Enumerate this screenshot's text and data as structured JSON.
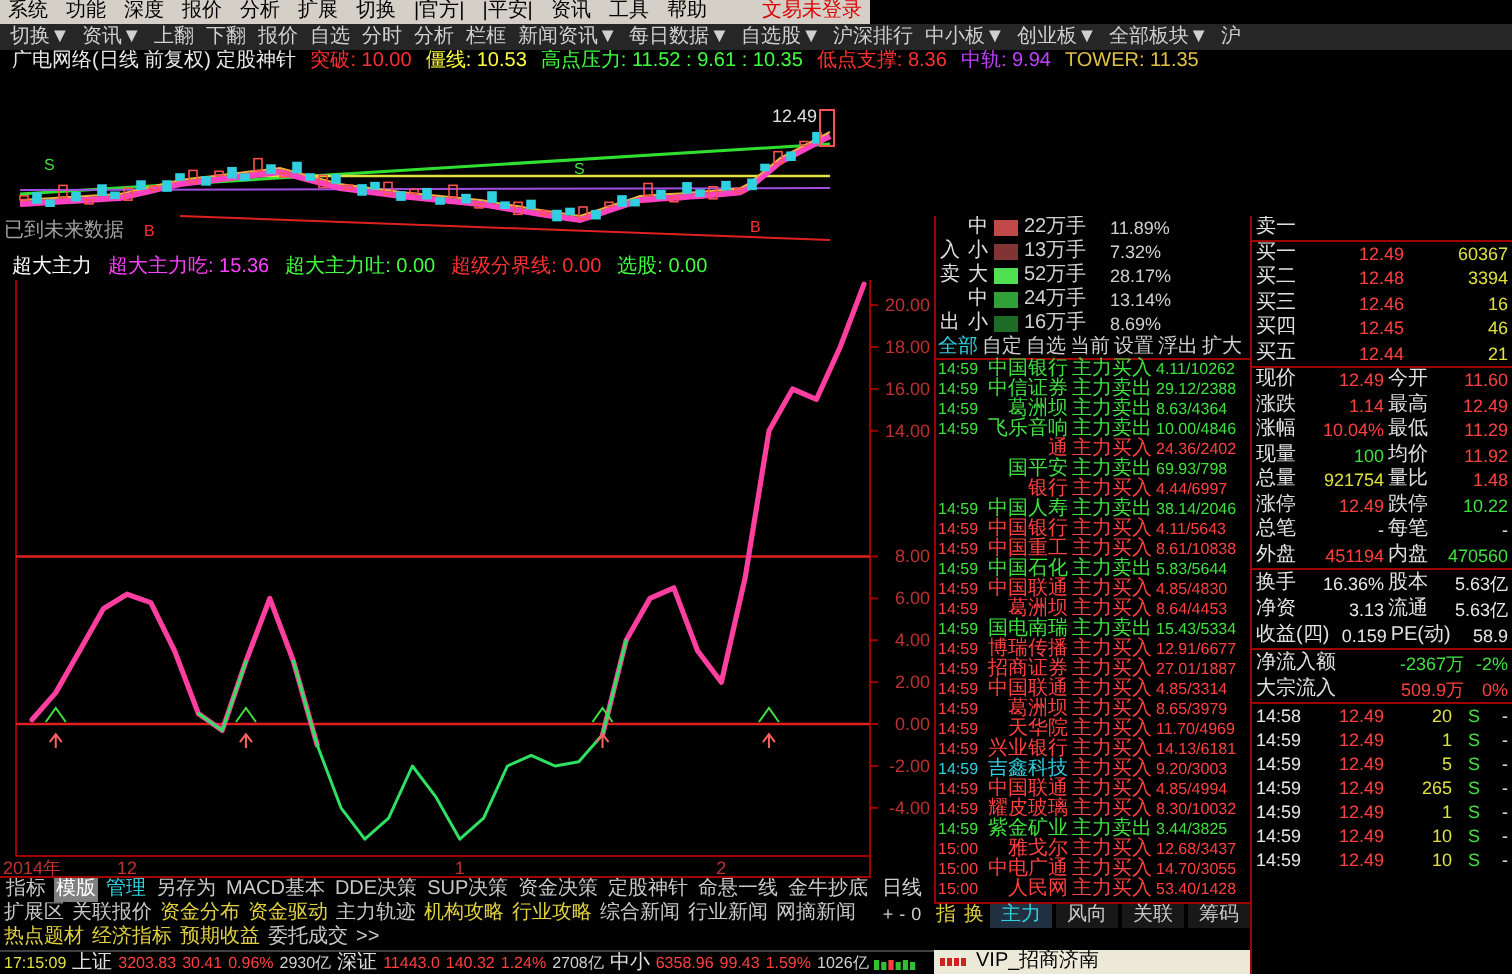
{
  "menu": {
    "items": [
      "系统",
      "功能",
      "深度",
      "报价",
      "分析",
      "扩展",
      "切换",
      "|官方|",
      "|平安|",
      "资讯",
      "工具",
      "帮助"
    ],
    "login_status": "文易未登录"
  },
  "toolbar": [
    "切换▼",
    "资讯▼",
    "上翻",
    "下翻",
    "报价",
    "自选",
    "分时",
    "分析",
    "栏框",
    "新闻资讯▼",
    "每日数据▼",
    "自选股▼",
    "沪深排行",
    "中小板▼",
    "创业板▼",
    "全部板块▼",
    "沪"
  ],
  "chart_info": {
    "title": "广电网络(日线 前复权) 定股神针",
    "items": [
      {
        "text": "突破: 10.00",
        "color": "#ff3030"
      },
      {
        "text": "僵线: 10.53",
        "color": "#ffff40"
      },
      {
        "text": "高点压力: 11.52 : 9.61 : 10.35",
        "color": "#40ff40"
      },
      {
        "text": "低点支撑: 8.36",
        "color": "#ff3030"
      },
      {
        "text": "中轨: 9.94",
        "color": "#c040ff"
      },
      {
        "text": "TOWER: 11.35",
        "color": "#e0c040"
      }
    ]
  },
  "price_chart": {
    "last_price": "12.49",
    "notice": "已到未来数据",
    "signals": [
      {
        "kind": "sell",
        "label": "S"
      },
      {
        "kind": "buy",
        "label": "B"
      },
      {
        "kind": "sell",
        "label": "S"
      },
      {
        "kind": "buy",
        "label": "B"
      }
    ]
  },
  "indicator": {
    "title": "超大主力",
    "values": [
      {
        "text": "超大主力吃: 15.36",
        "color": "#ff40ff"
      },
      {
        "text": "超大主力吐: 0.00",
        "color": "#40ff40"
      },
      {
        "text": "超级分界线: 0.00",
        "color": "#ff3030"
      },
      {
        "text": "选股: 0.00",
        "color": "#40ff40"
      }
    ],
    "chart_data": {
      "type": "line",
      "categories": [
        "2014年",
        null,
        null,
        null,
        "12",
        null,
        null,
        null,
        null,
        null,
        null,
        null,
        null,
        null,
        null,
        null,
        null,
        null,
        "1",
        null,
        null,
        null,
        null,
        null,
        null,
        null,
        null,
        null,
        null,
        "2",
        null,
        null,
        null,
        null,
        null,
        null
      ],
      "series": [
        {
          "color": "#ff3fa0",
          "values": [
            0.2,
            1.5,
            3.5,
            5.5,
            6.2,
            5.8,
            3.5,
            0.5,
            -0.3,
            3,
            6,
            3,
            -1,
            null,
            null,
            null,
            null,
            null,
            null,
            null,
            null,
            null,
            null,
            null,
            -0.5,
            4,
            6,
            6.5,
            3.5,
            2,
            7,
            14,
            16,
            15.5,
            18,
            21
          ]
        },
        {
          "color": "#30e060",
          "values": [
            null,
            null,
            null,
            null,
            null,
            null,
            null,
            0.5,
            -0.3,
            3,
            null,
            3,
            -1,
            -4,
            -5.5,
            -4.5,
            -2,
            -3.5,
            -5.5,
            -4.5,
            -2,
            -1.5,
            -2,
            -1.8,
            -0.5,
            4,
            null,
            null,
            null,
            null,
            null,
            null,
            null,
            null,
            null,
            null
          ]
        }
      ],
      "ylim": [
        -6.3,
        21.2
      ],
      "yticks": [
        {
          "value": 20,
          "label": "20.00"
        },
        {
          "value": 18,
          "label": "18.00"
        },
        {
          "value": 16,
          "label": "16.00"
        },
        {
          "value": 14,
          "label": "14.00"
        },
        {
          "value": 8,
          "label": "8.00"
        },
        {
          "value": 6,
          "label": "6.00"
        },
        {
          "value": 4,
          "label": "4.00"
        },
        {
          "value": 2,
          "label": "2.00"
        },
        {
          "value": 0,
          "label": "0.00"
        },
        {
          "value": -2,
          "label": "-2.00"
        },
        {
          "value": -4,
          "label": "-4.00"
        }
      ]
    }
  },
  "indicator_tabs": [
    {
      "label": "指标",
      "selected": false,
      "highlighted": false
    },
    {
      "label": "模版",
      "selected": true,
      "highlighted": false
    },
    {
      "label": "管理",
      "selected": false,
      "highlighted": true
    },
    {
      "label": "另存为",
      "selected": false,
      "highlighted": false
    },
    {
      "label": "MACD基本",
      "selected": false,
      "highlighted": false
    },
    {
      "label": "DDE决策",
      "selected": false,
      "highlighted": false
    },
    {
      "label": "SUP决策",
      "selected": false,
      "highlighted": false
    },
    {
      "label": "资金决策",
      "selected": false,
      "highlighted": false
    },
    {
      "label": "定股神针",
      "selected": false,
      "highlighted": false
    },
    {
      "label": "命悬一线",
      "selected": false,
      "highlighted": false
    },
    {
      "label": "金牛抄底",
      "selected": false,
      "highlighted": false
    }
  ],
  "period": "日线",
  "zoom_controls": [
    "+",
    "-",
    "0"
  ],
  "extension_tabs": [
    {
      "label": "扩展区",
      "highlighted": false
    },
    {
      "label": "关联报价",
      "highlighted": false
    },
    {
      "label": "资金分布",
      "highlighted": true
    },
    {
      "label": "资金驱动",
      "highlighted": true
    },
    {
      "label": "主力轨迹",
      "highlighted": false
    },
    {
      "label": "机构攻略",
      "highlighted": true
    },
    {
      "label": "行业攻略",
      "highlighted": true
    },
    {
      "label": "综合新闻",
      "highlighted": false
    },
    {
      "label": "行业新闻",
      "highlighted": false
    },
    {
      "label": "网摘新闻",
      "highlighted": false
    },
    {
      "label": "热点题材",
      "highlighted": true
    },
    {
      "label": "经济指标",
      "highlighted": true
    },
    {
      "label": "预期收益",
      "highlighted": true
    },
    {
      "label": "委托成交",
      "highlighted": false
    },
    {
      "label": ">>",
      "highlighted": false
    }
  ],
  "status_bar": {
    "time": "17:15:09",
    "indices": [
      {
        "name": "上证",
        "value": "3203.83",
        "change": "30.41",
        "percent": "0.96%",
        "amount": "2930亿"
      },
      {
        "name": "深证",
        "value": "11443.0",
        "change": "140.32",
        "percent": "1.24%",
        "amount": "2708亿"
      },
      {
        "name": "中小",
        "value": "6358.96",
        "change": "99.43",
        "percent": "1.59%",
        "amount": "1026亿"
      }
    ]
  },
  "vip_label": "VIP_招商济南",
  "money_flow": {
    "rows": [
      {
        "size": "中",
        "amount": "22万手",
        "percent": "11.89%",
        "color": "#c04848"
      },
      {
        "side": "入",
        "size": "小",
        "amount": "13万手",
        "percent": "7.32%",
        "color": "#803434"
      },
      {
        "side": "卖",
        "size": "大",
        "amount": "52万手",
        "percent": "28.17%",
        "color": "#50e050"
      },
      {
        "size": "中",
        "amount": "24万手",
        "percent": "13.14%",
        "color": "#30a038"
      },
      {
        "side": "出",
        "size": "小",
        "amount": "16万手",
        "percent": "8.69%",
        "color": "#206a28"
      }
    ],
    "actions": [
      {
        "label": "全部",
        "selected": true
      },
      {
        "label": "自定",
        "selected": false
      },
      {
        "label": "自选",
        "selected": false
      },
      {
        "label": "当前",
        "selected": false
      },
      {
        "label": "设置",
        "selected": false
      },
      {
        "label": "浮出",
        "selected": false
      },
      {
        "label": "扩大",
        "selected": false
      }
    ]
  },
  "trades": [
    {
      "time": "14:59",
      "name": "中国银行",
      "type": "主力买入",
      "detail": "4.11/10262",
      "color": "#40e040",
      "selected": false
    },
    {
      "time": "14:59",
      "name": "中信证券",
      "type": "主力卖出",
      "detail": "29.12/2388",
      "color": "#40e040",
      "selected": false
    },
    {
      "time": "14:59",
      "name": "葛洲坝",
      "type": "主力卖出",
      "detail": "8.63/4364",
      "color": "#40e040",
      "selected": false
    },
    {
      "time": "14:59",
      "name": "飞乐音响",
      "type": "主力卖出",
      "detail": "10.00/4846",
      "color": "#40e040",
      "selected": false
    },
    {
      "name": "通",
      "type": "主力买入",
      "detail": "24.36/2402",
      "color": "#ff4040",
      "selected": false
    },
    {
      "name": "国平安",
      "type": "主力卖出",
      "detail": "69.93/798",
      "color": "#40e040",
      "selected": false
    },
    {
      "name": "银行",
      "type": "主力买入",
      "detail": "4.44/6997",
      "color": "#ff4040",
      "selected": false
    },
    {
      "time": "14:59",
      "name": "中国人寿",
      "type": "主力卖出",
      "detail": "38.14/2046",
      "color": "#40e040",
      "selected": false
    },
    {
      "time": "14:59",
      "name": "中国银行",
      "type": "主力买入",
      "detail": "4.11/5643",
      "color": "#ff4040",
      "selected": false
    },
    {
      "time": "14:59",
      "name": "中国重工",
      "type": "主力买入",
      "detail": "8.61/10838",
      "color": "#ff4040",
      "selected": false
    },
    {
      "time": "14:59",
      "name": "中国石化",
      "type": "主力卖出",
      "detail": "5.83/5644",
      "color": "#40e040",
      "selected": false
    },
    {
      "time": "14:59",
      "name": "中国联通",
      "type": "主力买入",
      "detail": "4.85/4830",
      "color": "#ff4040",
      "selected": false
    },
    {
      "time": "14:59",
      "name": "葛洲坝",
      "type": "主力买入",
      "detail": "8.64/4453",
      "color": "#ff4040",
      "selected": false
    },
    {
      "time": "14:59",
      "name": "国电南瑞",
      "type": "主力卖出",
      "detail": "15.43/5334",
      "color": "#40e040",
      "selected": false
    },
    {
      "time": "14:59",
      "name": "博瑞传播",
      "type": "主力买入",
      "detail": "12.91/6677",
      "color": "#ff4040",
      "selected": false
    },
    {
      "time": "14:59",
      "name": "招商证券",
      "type": "主力买入",
      "detail": "27.01/1887",
      "color": "#ff4040",
      "selected": false
    },
    {
      "time": "14:59",
      "name": "中国联通",
      "type": "主力买入",
      "detail": "4.85/3314",
      "color": "#ff4040",
      "selected": false
    },
    {
      "time": "14:59",
      "name": "葛洲坝",
      "type": "主力买入",
      "detail": "8.65/3979",
      "color": "#ff4040",
      "selected": false
    },
    {
      "time": "14:59",
      "name": "天华院",
      "type": "主力买入",
      "detail": "11.70/4969",
      "color": "#ff4040",
      "selected": false
    },
    {
      "time": "14:59",
      "name": "兴业银行",
      "type": "主力买入",
      "detail": "14.13/6181",
      "color": "#ff4040",
      "selected": false
    },
    {
      "time": "14:59",
      "name": "吉鑫科技",
      "type": "主力买入",
      "detail": "9.20/3003",
      "color": "#ff4040",
      "selected": true
    },
    {
      "time": "14:59",
      "name": "中国联通",
      "type": "主力买入",
      "detail": "4.85/4994",
      "color": "#ff4040",
      "selected": false
    },
    {
      "time": "14:59",
      "name": "耀皮玻璃",
      "type": "主力买入",
      "detail": "8.30/10032",
      "color": "#ff4040",
      "selected": false
    },
    {
      "time": "14:59",
      "name": "紫金矿业",
      "type": "主力卖出",
      "detail": "3.44/3825",
      "color": "#40e040",
      "selected": false
    },
    {
      "time": "15:00",
      "name": "雅戈尔",
      "type": "主力买入",
      "detail": "12.68/3437",
      "color": "#ff4040",
      "selected": false
    },
    {
      "time": "15:00",
      "name": "中电广通",
      "type": "主力买入",
      "detail": "14.70/3055",
      "color": "#ff4040",
      "selected": false
    },
    {
      "time": "15:00",
      "name": "人民网",
      "type": "主力买入",
      "detail": "53.40/1428",
      "color": "#ff4040",
      "selected": false
    }
  ],
  "side_tabs": {
    "shortcuts": [
      "指",
      "换"
    ],
    "tabs": [
      {
        "label": "主力",
        "selected": true
      },
      {
        "label": "风向",
        "selected": false
      },
      {
        "label": "关联",
        "selected": false
      },
      {
        "label": "筹码",
        "selected": false
      }
    ]
  },
  "quote": {
    "depth": [
      {
        "label": "卖一"
      },
      {
        "label": "买一",
        "price": "12.49",
        "volume": "60367"
      },
      {
        "label": "买二",
        "price": "12.48",
        "volume": "3394"
      },
      {
        "label": "买三",
        "price": "12.46",
        "volume": "16"
      },
      {
        "label": "买四",
        "price": "12.45",
        "volume": "46"
      },
      {
        "label": "买五",
        "price": "12.44",
        "volume": "21"
      }
    ],
    "stats": [
      [
        {
          "label": "现价",
          "value": "12.49",
          "color": "#ff4040"
        },
        {
          "label": "今开",
          "value": "11.60",
          "color": "#ff4040"
        }
      ],
      [
        {
          "label": "涨跌",
          "value": "1.14",
          "color": "#ff4040"
        },
        {
          "label": "最高",
          "value": "12.49",
          "color": "#ff4040"
        }
      ],
      [
        {
          "label": "涨幅",
          "value": "10.04%",
          "color": "#ff4040"
        },
        {
          "label": "最低",
          "value": "11.29",
          "color": "#ff4040"
        }
      ],
      [
        {
          "label": "现量",
          "value": "100",
          "color": "#40e040"
        },
        {
          "label": "均价",
          "value": "11.92",
          "color": "#ff4040"
        }
      ],
      [
        {
          "label": "总量",
          "value": "921754",
          "color": "#e0e040"
        },
        {
          "label": "量比",
          "value": "1.48",
          "color": "#ff4040"
        }
      ],
      [
        {
          "label": "涨停",
          "value": "12.49",
          "color": "#ff4040"
        },
        {
          "label": "跌停",
          "value": "10.22",
          "color": "#40e040"
        }
      ],
      [
        {
          "label": "总笔",
          "value": "-"
        },
        {
          "label": "每笔",
          "value": "-"
        }
      ],
      [
        {
          "label": "外盘",
          "value": "451194",
          "color": "#ff4040"
        },
        {
          "label": "内盘",
          "value": "470560",
          "color": "#40e040"
        }
      ]
    ],
    "fundamentals": [
      [
        {
          "label": "换手",
          "value": "16.36%"
        },
        {
          "label": "股本",
          "value": "5.63亿"
        }
      ],
      [
        {
          "label": "净资",
          "value": "3.13"
        },
        {
          "label": "流通",
          "value": "5.63亿"
        }
      ],
      [
        {
          "label": "收益(四)",
          "value": "0.159"
        },
        {
          "label": "PE(动)",
          "value": "58.9"
        }
      ]
    ],
    "flows": [
      {
        "label": "净流入额",
        "amount": "-2367万",
        "percent": "-2%",
        "color": "#40e040"
      },
      {
        "label": "大宗流入",
        "amount": "509.9万",
        "percent": "0%",
        "color": "#ff4040"
      }
    ],
    "ticks": [
      {
        "time": "14:58",
        "price": "12.49",
        "volume": "20",
        "side": "S",
        "flag": "-"
      },
      {
        "time": "14:59",
        "price": "12.49",
        "volume": "1",
        "side": "S",
        "flag": "-"
      },
      {
        "time": "14:59",
        "price": "12.49",
        "volume": "5",
        "side": "S",
        "flag": "-"
      },
      {
        "time": "14:59",
        "price": "12.49",
        "volume": "265",
        "side": "S",
        "flag": "-"
      },
      {
        "time": "14:59",
        "price": "12.49",
        "volume": "1",
        "side": "S",
        "flag": "-"
      },
      {
        "time": "14:59",
        "price": "12.49",
        "volume": "10",
        "side": "S",
        "flag": "-"
      },
      {
        "time": "14:59",
        "price": "12.49",
        "volume": "10",
        "side": "S",
        "flag": "-"
      }
    ]
  }
}
